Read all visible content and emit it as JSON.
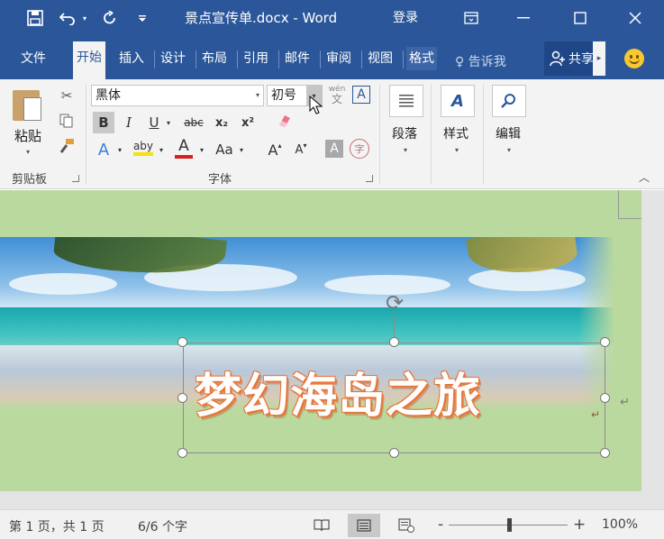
{
  "window": {
    "document_title": "景点宣传单.docx - Word",
    "login": "登录"
  },
  "qat": {
    "save_icon": "save-icon",
    "undo_icon": "undo-icon",
    "redo_icon": "redo-icon",
    "customize_icon": "customize-qat-icon"
  },
  "tabs": [
    {
      "label": "文件"
    },
    {
      "label": "开始"
    },
    {
      "label": "插入"
    },
    {
      "label": "设计"
    },
    {
      "label": "布局"
    },
    {
      "label": "引用"
    },
    {
      "label": "邮件"
    },
    {
      "label": "审阅"
    },
    {
      "label": "视图"
    },
    {
      "label": "格式"
    }
  ],
  "tell_me": "告诉我",
  "share": "共享",
  "ribbon": {
    "clipboard": {
      "paste": "粘贴",
      "label": "剪贴板"
    },
    "font": {
      "name": "黑体",
      "size": "初号",
      "bold": "B",
      "italic": "I",
      "underline": "U",
      "strike": "abc",
      "subscript": "x₂",
      "superscript": "x²",
      "phonetic": "wén",
      "phonetic_sub": "文",
      "char_border": "A",
      "text_effect": "A",
      "highlight": "aby",
      "font_color": "A",
      "change_case": "Aa",
      "grow": "A",
      "shrink": "A",
      "char_shading": "A",
      "enclose": "字",
      "label": "字体"
    },
    "paragraph": {
      "label": "段落"
    },
    "styles": {
      "label": "样式"
    },
    "editing": {
      "label": "编辑"
    }
  },
  "document": {
    "headline": "梦幻海岛之旅"
  },
  "status": {
    "page": "第 1 页，共 1 页",
    "words": "6/6 个字",
    "zoom": "100%",
    "zoom_level": 0.5
  },
  "colors": {
    "brand": "#2b579a",
    "page_bg": "#bad99e",
    "headline_outline": "#e8763a"
  }
}
